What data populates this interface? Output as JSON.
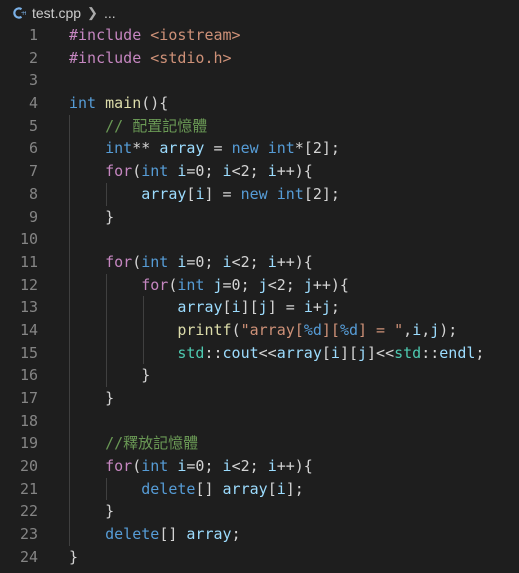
{
  "breadcrumb": {
    "file": "test.cpp",
    "more": "..."
  },
  "colors": {
    "background": "#1e1e1e",
    "keyword": "#569cd6",
    "preprocessor": "#c586c0",
    "string": "#ce9178",
    "comment": "#6a9955",
    "variable": "#9cdcfe",
    "function": "#dcdcaa",
    "namespace": "#4ec9b0"
  },
  "lines": [
    {
      "n": "1",
      "indent": 0,
      "tokens": [
        {
          "t": "#include",
          "c": "pp"
        },
        {
          "t": " "
        },
        {
          "t": "<iostream>",
          "c": "str"
        }
      ]
    },
    {
      "n": "2",
      "indent": 0,
      "tokens": [
        {
          "t": "#include",
          "c": "pp"
        },
        {
          "t": " "
        },
        {
          "t": "<stdio.h>",
          "c": "str"
        }
      ]
    },
    {
      "n": "3",
      "indent": 0,
      "tokens": []
    },
    {
      "n": "4",
      "indent": 0,
      "tokens": [
        {
          "t": "int",
          "c": "kw"
        },
        {
          "t": " "
        },
        {
          "t": "main",
          "c": "fn"
        },
        {
          "t": "(){"
        }
      ]
    },
    {
      "n": "5",
      "indent": 1,
      "tokens": [
        {
          "t": "    "
        },
        {
          "t": "// 配置記憶體",
          "c": "cmt"
        }
      ]
    },
    {
      "n": "6",
      "indent": 1,
      "tokens": [
        {
          "t": "    "
        },
        {
          "t": "int",
          "c": "kw"
        },
        {
          "t": "** "
        },
        {
          "t": "array",
          "c": "var"
        },
        {
          "t": " = "
        },
        {
          "t": "new",
          "c": "kw"
        },
        {
          "t": " "
        },
        {
          "t": "int",
          "c": "kw"
        },
        {
          "t": "*[2];"
        }
      ]
    },
    {
      "n": "7",
      "indent": 1,
      "tokens": [
        {
          "t": "    "
        },
        {
          "t": "for",
          "c": "pp"
        },
        {
          "t": "("
        },
        {
          "t": "int",
          "c": "kw"
        },
        {
          "t": " "
        },
        {
          "t": "i",
          "c": "var"
        },
        {
          "t": "=0; "
        },
        {
          "t": "i",
          "c": "var"
        },
        {
          "t": "<2; "
        },
        {
          "t": "i",
          "c": "var"
        },
        {
          "t": "++){"
        }
      ]
    },
    {
      "n": "8",
      "indent": 2,
      "tokens": [
        {
          "t": "        "
        },
        {
          "t": "array",
          "c": "var"
        },
        {
          "t": "["
        },
        {
          "t": "i",
          "c": "var"
        },
        {
          "t": "] = "
        },
        {
          "t": "new",
          "c": "kw"
        },
        {
          "t": " "
        },
        {
          "t": "int",
          "c": "kw"
        },
        {
          "t": "[2];"
        }
      ]
    },
    {
      "n": "9",
      "indent": 1,
      "tokens": [
        {
          "t": "    }"
        }
      ]
    },
    {
      "n": "10",
      "indent": 1,
      "tokens": []
    },
    {
      "n": "11",
      "indent": 1,
      "tokens": [
        {
          "t": "    "
        },
        {
          "t": "for",
          "c": "pp"
        },
        {
          "t": "("
        },
        {
          "t": "int",
          "c": "kw"
        },
        {
          "t": " "
        },
        {
          "t": "i",
          "c": "var"
        },
        {
          "t": "=0; "
        },
        {
          "t": "i",
          "c": "var"
        },
        {
          "t": "<2; "
        },
        {
          "t": "i",
          "c": "var"
        },
        {
          "t": "++){"
        }
      ]
    },
    {
      "n": "12",
      "indent": 2,
      "tokens": [
        {
          "t": "        "
        },
        {
          "t": "for",
          "c": "pp"
        },
        {
          "t": "("
        },
        {
          "t": "int",
          "c": "kw"
        },
        {
          "t": " "
        },
        {
          "t": "j",
          "c": "var"
        },
        {
          "t": "=0; "
        },
        {
          "t": "j",
          "c": "var"
        },
        {
          "t": "<2; "
        },
        {
          "t": "j",
          "c": "var"
        },
        {
          "t": "++){"
        }
      ]
    },
    {
      "n": "13",
      "indent": 3,
      "tokens": [
        {
          "t": "            "
        },
        {
          "t": "array",
          "c": "var"
        },
        {
          "t": "["
        },
        {
          "t": "i",
          "c": "var"
        },
        {
          "t": "]["
        },
        {
          "t": "j",
          "c": "var"
        },
        {
          "t": "] = "
        },
        {
          "t": "i",
          "c": "var"
        },
        {
          "t": "+"
        },
        {
          "t": "j",
          "c": "var"
        },
        {
          "t": ";"
        }
      ]
    },
    {
      "n": "14",
      "indent": 3,
      "tokens": [
        {
          "t": "            "
        },
        {
          "t": "printf",
          "c": "fn"
        },
        {
          "t": "("
        },
        {
          "t": "\"array[",
          "c": "str"
        },
        {
          "t": "%d",
          "c": "kw"
        },
        {
          "t": "][",
          "c": "str"
        },
        {
          "t": "%d",
          "c": "kw"
        },
        {
          "t": "] = \"",
          "c": "str"
        },
        {
          "t": ","
        },
        {
          "t": "i",
          "c": "var"
        },
        {
          "t": ","
        },
        {
          "t": "j",
          "c": "var"
        },
        {
          "t": ");"
        }
      ]
    },
    {
      "n": "15",
      "indent": 3,
      "tokens": [
        {
          "t": "            "
        },
        {
          "t": "std",
          "c": "ns"
        },
        {
          "t": "::"
        },
        {
          "t": "cout",
          "c": "var"
        },
        {
          "t": "<<"
        },
        {
          "t": "array",
          "c": "var"
        },
        {
          "t": "["
        },
        {
          "t": "i",
          "c": "var"
        },
        {
          "t": "]["
        },
        {
          "t": "j",
          "c": "var"
        },
        {
          "t": "]<<"
        },
        {
          "t": "std",
          "c": "ns"
        },
        {
          "t": "::"
        },
        {
          "t": "endl",
          "c": "var"
        },
        {
          "t": ";"
        }
      ]
    },
    {
      "n": "16",
      "indent": 2,
      "tokens": [
        {
          "t": "        }"
        }
      ]
    },
    {
      "n": "17",
      "indent": 1,
      "tokens": [
        {
          "t": "    }"
        }
      ]
    },
    {
      "n": "18",
      "indent": 1,
      "tokens": []
    },
    {
      "n": "19",
      "indent": 1,
      "tokens": [
        {
          "t": "    "
        },
        {
          "t": "//釋放記憶體",
          "c": "cmt"
        }
      ]
    },
    {
      "n": "20",
      "indent": 1,
      "tokens": [
        {
          "t": "    "
        },
        {
          "t": "for",
          "c": "pp"
        },
        {
          "t": "("
        },
        {
          "t": "int",
          "c": "kw"
        },
        {
          "t": " "
        },
        {
          "t": "i",
          "c": "var"
        },
        {
          "t": "=0; "
        },
        {
          "t": "i",
          "c": "var"
        },
        {
          "t": "<2; "
        },
        {
          "t": "i",
          "c": "var"
        },
        {
          "t": "++){"
        }
      ]
    },
    {
      "n": "21",
      "indent": 2,
      "tokens": [
        {
          "t": "        "
        },
        {
          "t": "delete",
          "c": "kw"
        },
        {
          "t": "[] "
        },
        {
          "t": "array",
          "c": "var"
        },
        {
          "t": "["
        },
        {
          "t": "i",
          "c": "var"
        },
        {
          "t": "];"
        }
      ]
    },
    {
      "n": "22",
      "indent": 1,
      "tokens": [
        {
          "t": "    }"
        }
      ]
    },
    {
      "n": "23",
      "indent": 1,
      "tokens": [
        {
          "t": "    "
        },
        {
          "t": "delete",
          "c": "kw"
        },
        {
          "t": "[] "
        },
        {
          "t": "array",
          "c": "var"
        },
        {
          "t": ";"
        }
      ]
    },
    {
      "n": "24",
      "indent": 0,
      "tokens": [
        {
          "t": "}"
        }
      ]
    }
  ]
}
